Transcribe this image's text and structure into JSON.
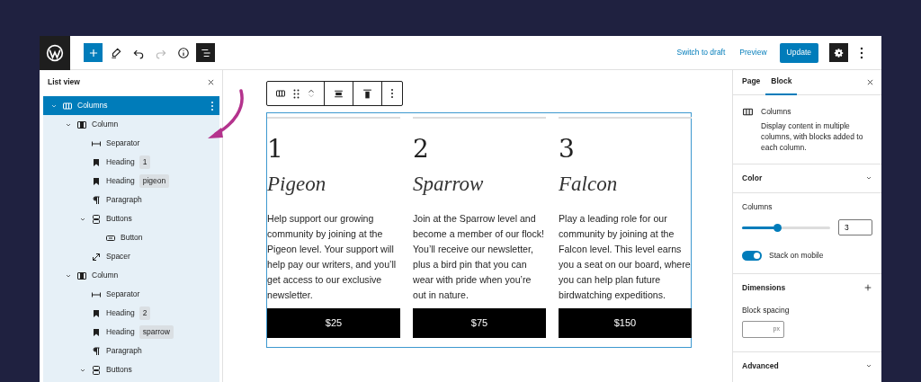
{
  "topbar": {
    "tools": [
      {
        "kind": "add",
        "selected": false,
        "disabled": false
      },
      {
        "kind": "edit",
        "selected": false,
        "disabled": false
      },
      {
        "kind": "undo",
        "selected": false,
        "disabled": false
      },
      {
        "kind": "redo",
        "selected": false,
        "disabled": true
      },
      {
        "kind": "info",
        "selected": false,
        "disabled": false
      },
      {
        "kind": "list-view",
        "selected": true,
        "disabled": false
      }
    ],
    "links": [
      "Switch to draft",
      "Preview"
    ],
    "primary": "Update",
    "settings_selected": true
  },
  "list_view": {
    "title": "List view",
    "items": [
      {
        "label": "Columns",
        "kind": "columns",
        "selected": true,
        "expanded": true,
        "children": [
          {
            "label": "Column",
            "kind": "column",
            "selected": false,
            "expanded": true,
            "children": [
              {
                "label": "Separator",
                "kind": "separator",
                "selected": false
              },
              {
                "label": "Heading",
                "kind": "heading",
                "badge": "1",
                "selected": false
              },
              {
                "label": "Heading",
                "kind": "heading",
                "badge": "pigeon",
                "selected": false
              },
              {
                "label": "Paragraph",
                "kind": "paragraph",
                "selected": false
              },
              {
                "label": "Buttons",
                "kind": "buttons",
                "selected": false,
                "expanded": true,
                "children": [
                  {
                    "label": "Button",
                    "kind": "button",
                    "selected": false
                  }
                ]
              },
              {
                "label": "Spacer",
                "kind": "spacer",
                "selected": false
              }
            ]
          },
          {
            "label": "Column",
            "kind": "column",
            "selected": false,
            "expanded": true,
            "children": [
              {
                "label": "Separator",
                "kind": "separator",
                "selected": false
              },
              {
                "label": "Heading",
                "kind": "heading",
                "badge": "2",
                "selected": false
              },
              {
                "label": "Heading",
                "kind": "heading",
                "badge": "sparrow",
                "selected": false
              },
              {
                "label": "Paragraph",
                "kind": "paragraph",
                "selected": false
              },
              {
                "label": "Buttons",
                "kind": "buttons",
                "selected": false,
                "expanded": true
              }
            ]
          }
        ]
      }
    ]
  },
  "canvas": {
    "columns": [
      {
        "number": "1",
        "title": "Pigeon",
        "text": "Help support our growing community by joining at the Pigeon level. Your support will help pay our writers, and you’ll get access to our exclusive newsletter.",
        "price": "$25"
      },
      {
        "number": "2",
        "title": "Sparrow",
        "text": "Join at the Sparrow level and become a member of our flock! You’ll receive our newsletter, plus a bird pin that you can wear with pride when you’re out in nature.",
        "price": "$75"
      },
      {
        "number": "3",
        "title": "Falcon",
        "text": "Play a leading role for our community by joining at the Falcon level. This level earns you a seat on our board, where you can help plan future birdwatching expeditions.",
        "price": "$150"
      }
    ]
  },
  "sidebar": {
    "tabs": [
      {
        "label": "Page",
        "selected": false
      },
      {
        "label": "Block",
        "selected": true
      }
    ],
    "block": {
      "name": "Columns",
      "description": "Display content in multiple columns, with blocks added to each column."
    },
    "color_panel": {
      "title": "Color",
      "expanded": false
    },
    "layout": {
      "label": "Columns",
      "level": 0.4,
      "value": "3",
      "toggle_label": "Stack on mobile",
      "on": true
    },
    "dimensions": {
      "title": "Dimensions",
      "spacing_label": "Block spacing",
      "unit": "px"
    },
    "advanced": {
      "title": "Advanced",
      "expanded": false
    }
  }
}
